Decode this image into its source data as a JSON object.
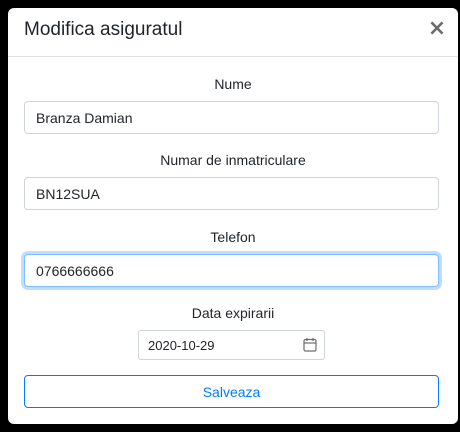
{
  "modal": {
    "title": "Modifica asiguratul",
    "close_label": "×"
  },
  "form": {
    "name": {
      "label": "Nume",
      "value": "Branza Damian"
    },
    "plate": {
      "label": "Numar de inmatriculare",
      "value": "BN12SUA"
    },
    "phone": {
      "label": "Telefon",
      "value": "0766666666"
    },
    "expiry": {
      "label": "Data expirarii",
      "value": "2020-10-29"
    },
    "save_label": "Salveaza"
  },
  "colors": {
    "accent": "#007bff",
    "focus_border": "#80bdff",
    "border": "#ced4da"
  },
  "icons": {
    "close": "close-icon",
    "calendar": "calendar-icon"
  }
}
